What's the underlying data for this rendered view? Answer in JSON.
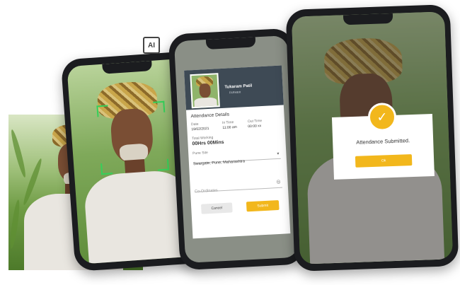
{
  "badge": {
    "ai_label": "AI"
  },
  "form": {
    "name": "Tukaram Patil",
    "role": "FARMER",
    "section_title": "Attendance Details",
    "date_label": "Date",
    "date_value": "19/02/2021",
    "in_time_label": "In Time",
    "in_time_value": "11:00 am",
    "out_time_label": "Out Time",
    "out_time_value": "00:00 xx",
    "total_working_label": "Total Working",
    "total_working_value": "00Hrs 00Mins",
    "site_label": "Pune Site",
    "site_value": "Swargate, Pune, Maharashtra",
    "coordinates_placeholder": "Co-Ordinates",
    "cancel_label": "Cancel",
    "submit_label": "Submit"
  },
  "dialog": {
    "message": "Attendance Submitted.",
    "ok_label": "Ok"
  },
  "colors": {
    "accent": "#f2b71c",
    "scan": "#35d05a",
    "header": "#3e4a55"
  }
}
